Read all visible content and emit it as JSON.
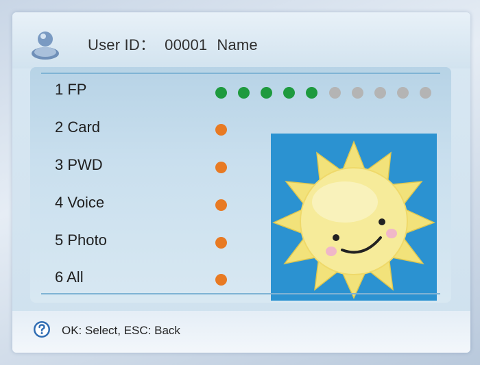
{
  "header": {
    "user_id_label": "User ID：",
    "user_id_value": "00001",
    "name_label": "Name",
    "icon": "user-icon"
  },
  "menu": {
    "items": [
      {
        "label": "1 FP",
        "status": "fingerprint-progress"
      },
      {
        "label": "2 Card",
        "status": "orange-dot"
      },
      {
        "label": "3 PWD",
        "status": "orange-dot"
      },
      {
        "label": "4 Voice",
        "status": "orange-dot"
      },
      {
        "label": "5 Photo",
        "status": "orange-dot"
      },
      {
        "label": "6 All",
        "status": "orange-dot"
      }
    ],
    "fp_progress": {
      "filled": 5,
      "total": 10
    },
    "colors": {
      "filled": "#1e9a3e",
      "empty": "#b4b4b4",
      "indicator": "#e87a23"
    }
  },
  "photo": {
    "icon": "smiling-sun-image",
    "background": "#2b92d1"
  },
  "footer": {
    "help_icon": "help-icon",
    "hint": "OK: Select, ESC: Back"
  }
}
